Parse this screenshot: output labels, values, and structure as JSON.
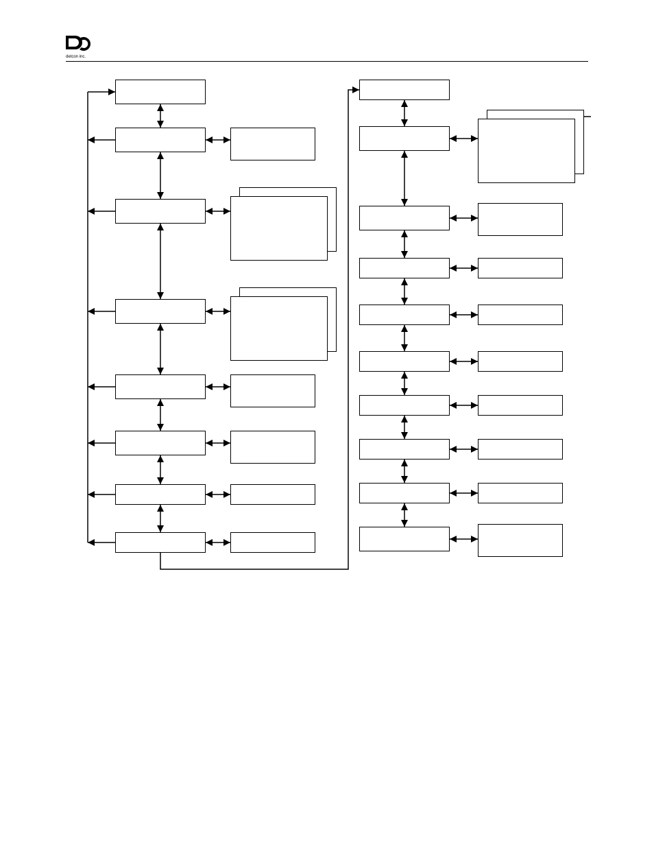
{
  "brand": {
    "name": "detcon inc."
  },
  "diagram": {
    "left_column": {
      "nodes": [
        {
          "id": "L0",
          "label": ""
        },
        {
          "id": "L1",
          "label": ""
        },
        {
          "id": "L2",
          "label": ""
        },
        {
          "id": "L3",
          "label": ""
        },
        {
          "id": "L4",
          "label": ""
        },
        {
          "id": "L5",
          "label": ""
        },
        {
          "id": "L6",
          "label": ""
        },
        {
          "id": "L7",
          "label": ""
        }
      ],
      "side_boxes": [
        {
          "id": "LS1",
          "label": ""
        },
        {
          "id": "LS2_back",
          "label": ""
        },
        {
          "id": "LS2",
          "label": ""
        },
        {
          "id": "LS3_back",
          "label": ""
        },
        {
          "id": "LS3",
          "label": ""
        },
        {
          "id": "LS4",
          "label": ""
        },
        {
          "id": "LS5",
          "label": ""
        },
        {
          "id": "LS6",
          "label": ""
        },
        {
          "id": "LS7",
          "label": ""
        }
      ]
    },
    "right_column": {
      "nodes": [
        {
          "id": "R0",
          "label": ""
        },
        {
          "id": "R1",
          "label": ""
        },
        {
          "id": "R2",
          "label": ""
        },
        {
          "id": "R3",
          "label": ""
        },
        {
          "id": "R4",
          "label": ""
        },
        {
          "id": "R5",
          "label": ""
        },
        {
          "id": "R6",
          "label": ""
        },
        {
          "id": "R7",
          "label": ""
        },
        {
          "id": "R8",
          "label": ""
        },
        {
          "id": "R9",
          "label": ""
        }
      ],
      "side_boxes": [
        {
          "id": "RS1_back",
          "label": ""
        },
        {
          "id": "RS1",
          "label": ""
        },
        {
          "id": "RS2",
          "label": ""
        },
        {
          "id": "RS3",
          "label": ""
        },
        {
          "id": "RS4",
          "label": ""
        },
        {
          "id": "RS5",
          "label": ""
        },
        {
          "id": "RS6",
          "label": ""
        },
        {
          "id": "RS7",
          "label": ""
        },
        {
          "id": "RS8",
          "label": ""
        },
        {
          "id": "RS9",
          "label": ""
        }
      ]
    }
  }
}
